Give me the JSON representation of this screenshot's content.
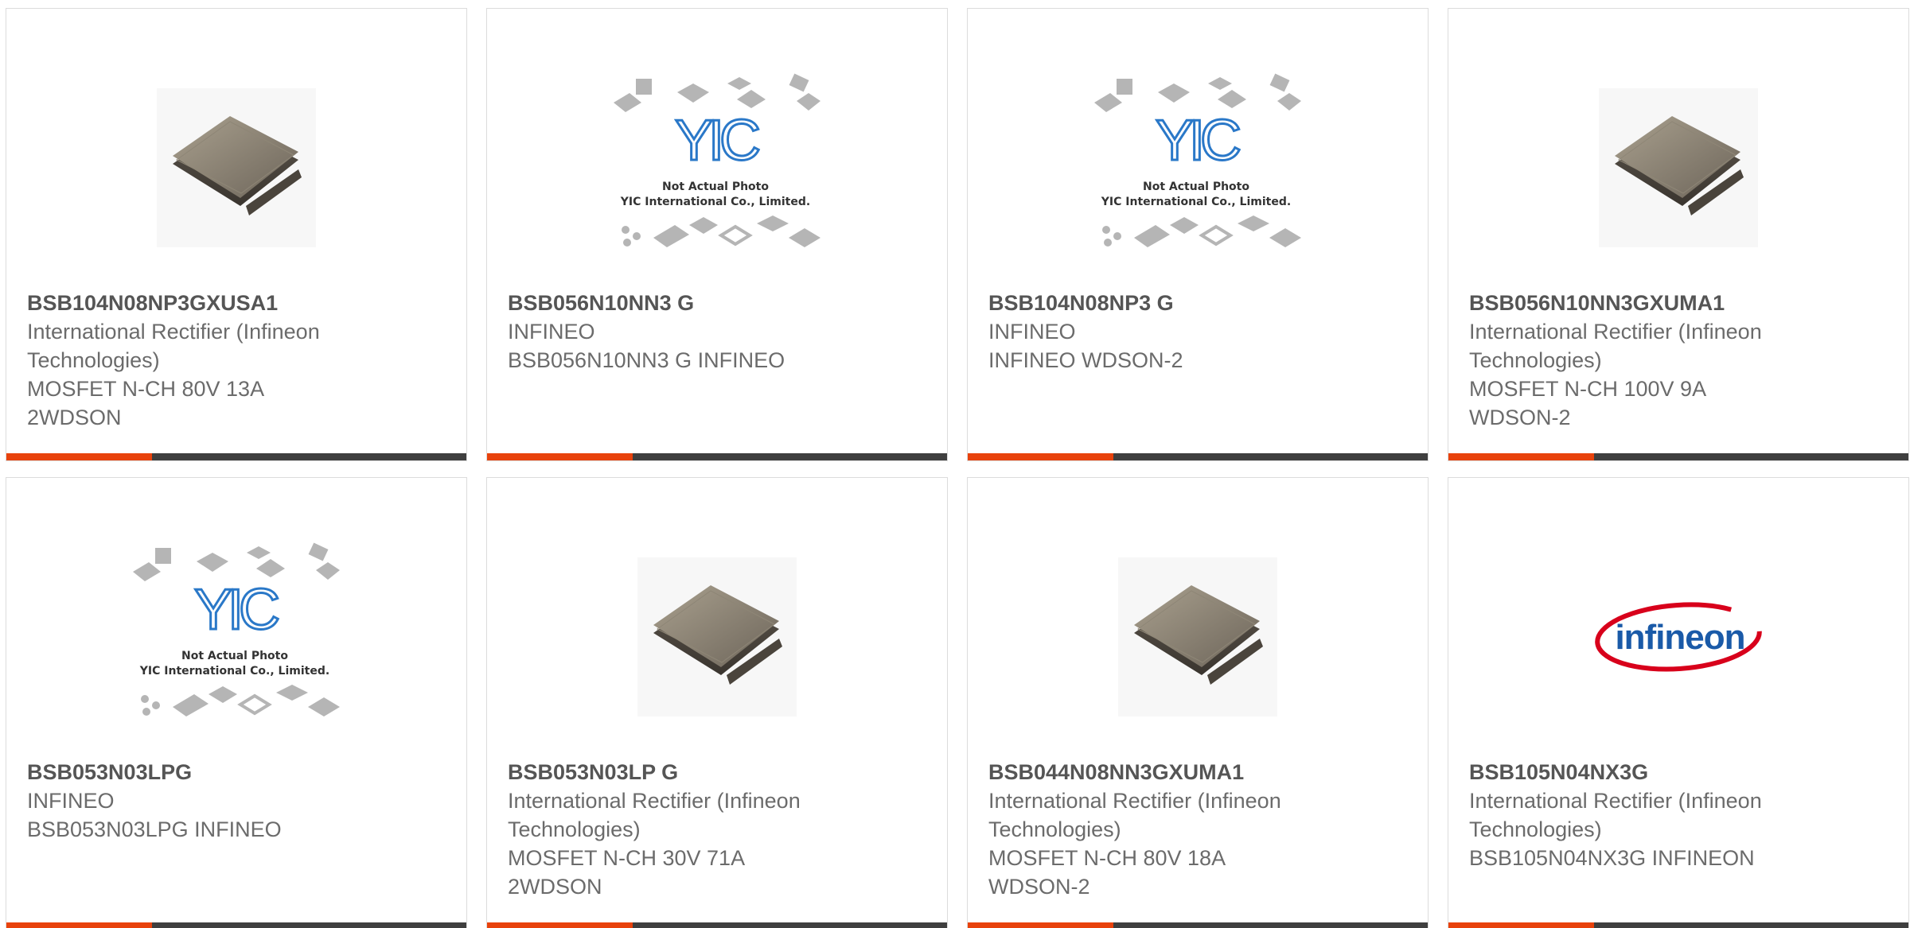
{
  "colors": {
    "accent": "#e8420c",
    "bar": "#3f3f3f",
    "yic_blue": "#2a78c8",
    "infineon_red": "#d8001b",
    "infineon_blue": "#1a5aa8"
  },
  "placeholder": {
    "line1": "Not Actual Photo",
    "line2": "YIC International Co., Limited."
  },
  "logo_text": "infineon",
  "products": [
    {
      "part": "BSB104N08NP3GXUSA1",
      "maker": "International Rectifier (Infineon Technologies)",
      "desc1": "MOSFET N-CH 80V 13A",
      "desc2": "2WDSON",
      "image": "chip-photo"
    },
    {
      "part": "BSB056N10NN3 G",
      "maker": "INFINEO",
      "desc1": "BSB056N10NN3 G INFINEO",
      "desc2": "",
      "image": "placeholder"
    },
    {
      "part": "BSB104N08NP3 G",
      "maker": "INFINEO",
      "desc1": "INFINEO WDSON-2",
      "desc2": "",
      "image": "placeholder"
    },
    {
      "part": "BSB056N10NN3GXUMA1",
      "maker": "International Rectifier (Infineon Technologies)",
      "desc1": "MOSFET N-CH 100V 9A",
      "desc2": "WDSON-2",
      "image": "chip-photo"
    },
    {
      "part": "BSB053N03LPG",
      "maker": "INFINEO",
      "desc1": "BSB053N03LPG INFINEO",
      "desc2": "",
      "image": "placeholder"
    },
    {
      "part": "BSB053N03LP G",
      "maker": "International Rectifier (Infineon Technologies)",
      "desc1": "MOSFET N-CH 30V 71A",
      "desc2": "2WDSON",
      "image": "chip-photo"
    },
    {
      "part": "BSB044N08NN3GXUMA1",
      "maker": "International Rectifier (Infineon Technologies)",
      "desc1": "MOSFET N-CH 80V 18A",
      "desc2": "WDSON-2",
      "image": "chip-photo"
    },
    {
      "part": "BSB105N04NX3G",
      "maker": "International Rectifier (Infineon Technologies)",
      "desc1": "BSB105N04NX3G INFINEON",
      "desc2": "",
      "image": "infineon-logo"
    }
  ]
}
